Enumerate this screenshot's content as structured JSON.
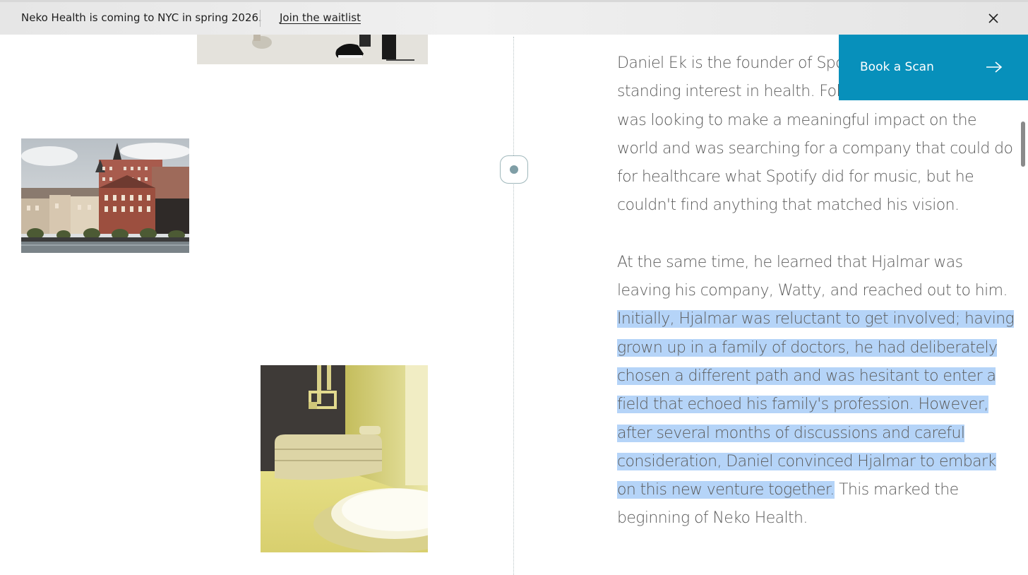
{
  "announcement": {
    "message": "Neko Health is coming to NYC in spring 2026.",
    "link_label": "Join the waitlist",
    "close_icon": "close-icon"
  },
  "cta": {
    "label": "Book a Scan",
    "icon": "arrow-right-icon",
    "color": "#0790bb"
  },
  "article": {
    "p1": "Daniel Ek is the founder of Spotify and has a long-standing interest in health. Following Spotify's IPO, he was looking to make a meaningful impact on the world and was searching for a company that could do for healthcare what Spotify did for music, but he couldn't find anything that matched his vision.",
    "p2_before": "At the same time, he learned that Hjalmar was leaving his company, Watty, and reached out to him. ",
    "p2_selected": "Initially, Hjalmar was reluctant to get involved; having grown up in a family of doctors, he had deliberately chosen a different path and was hesitant to enter a field that echoed his family's profession. However, after several months of discussions and careful consideration, Daniel convinced Hjalmar to embark on this new venture together.",
    "p2_after": " This marked the beginning of Neko Health.",
    "selection_color": "#b5d4f8"
  },
  "images": {
    "people": "people-photo",
    "stockholm": "stockholm-waterfront-photo",
    "clinic": "yellow-clinic-room-photo"
  }
}
